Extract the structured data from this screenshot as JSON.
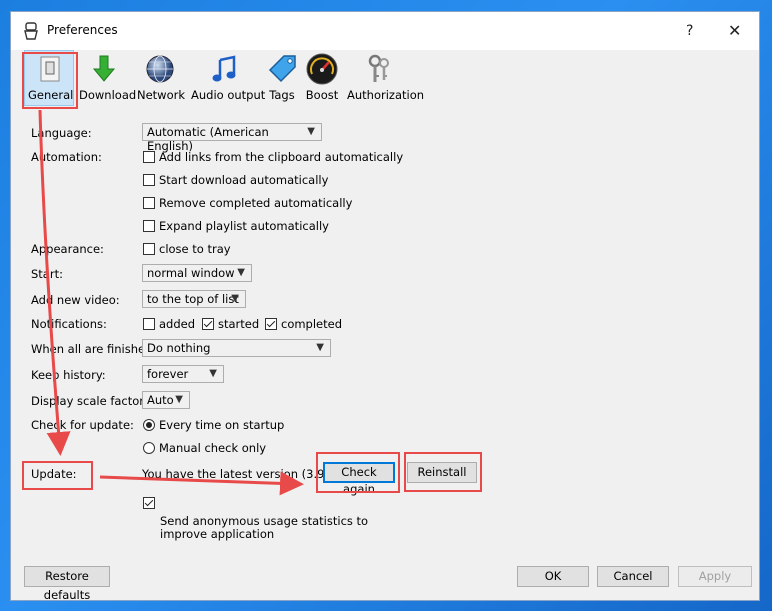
{
  "window": {
    "title": "Preferences",
    "help": "?",
    "close": "✕"
  },
  "toolbar": [
    {
      "label": "General",
      "icon": "general-switch-icon",
      "selected": true
    },
    {
      "label": "Download",
      "icon": "download-arrow-icon"
    },
    {
      "label": "Network",
      "icon": "globe-icon"
    },
    {
      "label": "Audio output",
      "icon": "music-note-icon"
    },
    {
      "label": "Tags",
      "icon": "tag-icon"
    },
    {
      "label": "Boost",
      "icon": "speedometer-icon"
    },
    {
      "label": "Authorization",
      "icon": "keys-icon"
    }
  ],
  "form": {
    "language": {
      "label": "Language:",
      "value": "Automatic (American English)"
    },
    "automation": {
      "label": "Automation:",
      "options": [
        {
          "text": "Add links from the clipboard automatically",
          "checked": false
        },
        {
          "text": "Start download automatically",
          "checked": false
        },
        {
          "text": "Remove completed automatically",
          "checked": false
        },
        {
          "text": "Expand playlist automatically",
          "checked": false
        }
      ]
    },
    "appearance": {
      "label": "Appearance:",
      "option": "close to tray",
      "checked": false
    },
    "start": {
      "label": "Start:",
      "value": "normal window"
    },
    "add_new_video": {
      "label": "Add new video:",
      "value": "to the top of list"
    },
    "notifications": {
      "label": "Notifications:",
      "options": [
        {
          "text": "added",
          "checked": false
        },
        {
          "text": "started",
          "checked": true
        },
        {
          "text": "completed",
          "checked": true
        }
      ]
    },
    "when_finished": {
      "label": "When all are finished:",
      "value": "Do nothing"
    },
    "keep_history": {
      "label": "Keep history:",
      "value": "forever"
    },
    "scale": {
      "label": "Display scale factor:",
      "value": "Auto"
    },
    "check_update": {
      "label": "Check for update:",
      "options": [
        {
          "text": "Every time on startup",
          "selected": true
        },
        {
          "text": "Manual check only",
          "selected": false
        }
      ]
    },
    "update": {
      "label": "Update:",
      "status": "You have the latest version (3.9.19)",
      "check_again": "Check again",
      "reinstall": "Reinstall"
    },
    "usage_stats": {
      "line1": "Send anonymous usage statistics to",
      "line2": "improve application",
      "checked": true
    }
  },
  "footer": {
    "restore": "Restore defaults",
    "ok": "OK",
    "cancel": "Cancel",
    "apply": "Apply"
  },
  "colors": {
    "annotation": "#e84a4a",
    "desktop": "#1f86e8",
    "selected_tab": "#cce4f7"
  }
}
